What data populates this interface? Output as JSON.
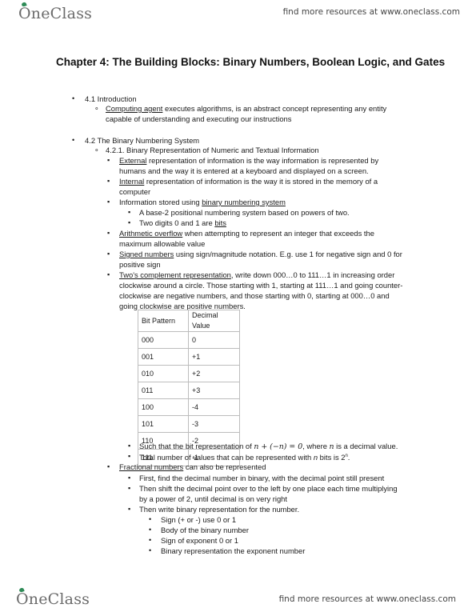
{
  "header": {
    "logo": "OneClass",
    "tagline": "find more resources at www.oneclass.com"
  },
  "footer": {
    "logo": "OneClass",
    "tagline": "find more resources at www.oneclass.com"
  },
  "title": "Chapter 4: The Building Blocks: Binary Numbers, Boolean Logic, and Gates",
  "sections": {
    "s41": {
      "heading": "4.1 Introduction",
      "item1_term": "Computing agent",
      "item1_rest": " executes algorithms, is an abstract concept representing any entity",
      "item1_cont": "capable of understanding and executing our instructions"
    },
    "s42": {
      "heading": "4.2 The Binary Numbering System",
      "sub": "4.2.1. Binary Representation of Numeric and Textual Information",
      "external_term": "External",
      "external_rest": " representation of information is the way information is represented by",
      "external_cont": "humans and the way it is entered at a keyboard and displayed on a screen.",
      "internal_term": "Internal",
      "internal_rest": " representation of information is the way it is stored in the memory of a",
      "internal_cont": "computer",
      "info_pre": "Information stored using ",
      "info_term": "binary numbering system",
      "base2": "A base-2 positional numbering system based on powers of two.",
      "bits_pre": "Two digits 0 and 1 are ",
      "bits_term": "bits",
      "overflow_term": "Arithmetic overflow",
      "overflow_rest": " when attempting to represent an integer that exceeds the",
      "overflow_cont": "maximum allowable value",
      "signed_term": "Signed numbers",
      "signed_rest": " using sign/magnitude notation. E.g. use 1 for negative sign and 0 for",
      "signed_cont": "positive sign",
      "twos_term": "Two's complement representation",
      "twos_rest": ", write down 000…0 to 111…1 in increasing order",
      "twos_cont1": "clockwise around a circle. Those starting with 1, starting at 111…1 and going counter-",
      "twos_cont2": "clockwise are negative numbers, and those starting with 0, starting at 000…0 and",
      "twos_cont3": "going clockwise are positive numbers.",
      "table": {
        "headers": [
          "Bit Pattern",
          "Decimal Value"
        ],
        "rows": [
          [
            "000",
            "0"
          ],
          [
            "001",
            "+1"
          ],
          [
            "010",
            "+2"
          ],
          [
            "011",
            "+3"
          ],
          [
            "100",
            "-4"
          ],
          [
            "101",
            "-3"
          ],
          [
            "110",
            "-2"
          ],
          [
            "111",
            "-1"
          ]
        ]
      },
      "such_pre": "Such that the bit representation of ",
      "such_math": "n + (−n) = 0",
      "such_mid": ", where ",
      "such_var": "n",
      "such_post": " is a decimal value.",
      "total_pre": "Total number of values that can be represented with ",
      "total_var": "n",
      "total_mid": " bits is 2",
      "total_sup": "n",
      "total_post": ".",
      "frac_term": "Fractional numbers",
      "frac_rest": " can also be represented",
      "frac_1": "First, find the decimal number in binary,  with the decimal point still present",
      "frac_2": "Then shift the decimal point over to the left by one place each time multiplying",
      "frac_2_cont": "by a power of 2, until decimal is on very right",
      "frac_3": "Then write binary representation for the number.",
      "frac_3_items": [
        "Sign (+ or -) use 0 or 1",
        "Body of the binary number",
        "Sign of exponent 0 or 1",
        "Binary representation the exponent number"
      ]
    }
  }
}
